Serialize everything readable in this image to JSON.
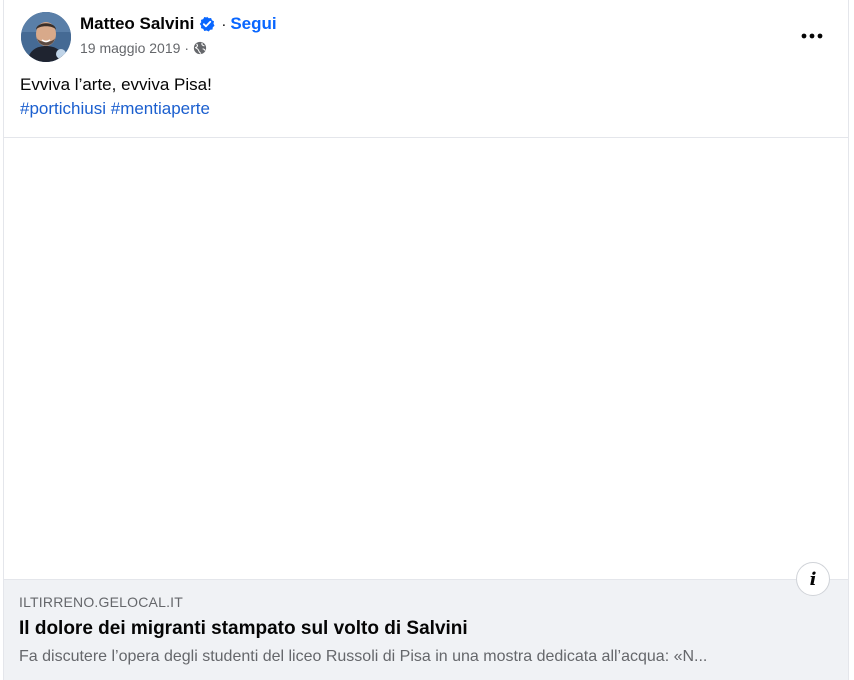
{
  "post": {
    "author": "Matteo Salvini",
    "separator": "·",
    "follow_label": "Segui",
    "date": "19 maggio 2019",
    "meta_separator": "·",
    "audience_icon": "globe-icon",
    "verified_icon": "verified-badge-icon",
    "more_icon": "more-options-icon",
    "text_line1": "Evviva l’arte, evviva Pisa!",
    "hashtags": [
      "#portichiusi",
      "#mentiaperte"
    ]
  },
  "link_preview": {
    "info_label": "i",
    "domain": "ILTIRRENO.GELOCAL.IT",
    "headline": "Il dolore dei migranti stampato sul volto di Salvini",
    "description": "Fa discutere l’opera degli studenti del liceo Russoli di Pisa in una mostra dedicata all’acqua: «N..."
  },
  "colors": {
    "link_blue": "#0866ff",
    "hashtag_blue": "#1b5fcf",
    "secondary_text": "#65676b",
    "link_box_bg": "#f0f2f5"
  }
}
